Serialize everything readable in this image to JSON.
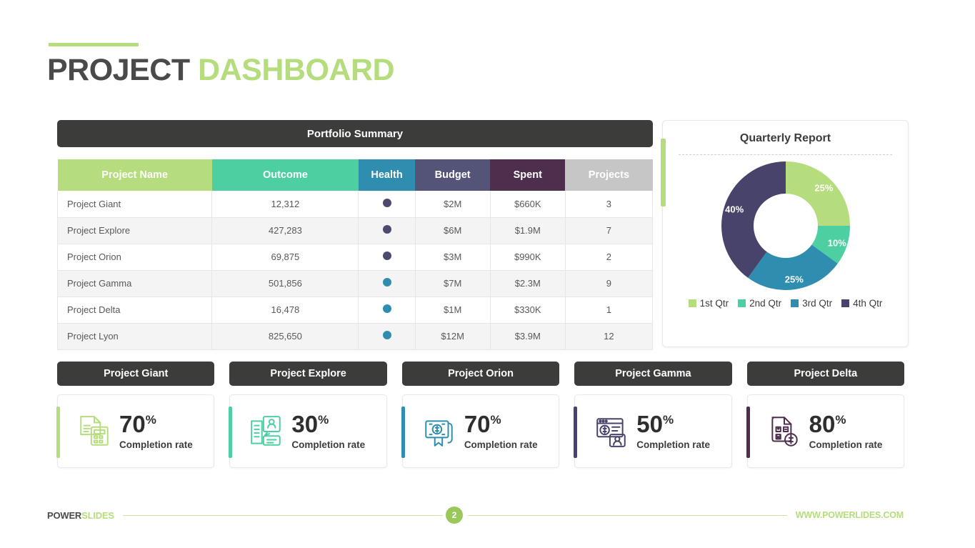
{
  "header": {
    "title_part1": "PROJECT",
    "title_part2": "DASHBOARD"
  },
  "portfolio": {
    "panel_title": "Portfolio Summary",
    "columns": [
      "Project Name",
      "Outcome",
      "Health",
      "Budget",
      "Spent",
      "Projects"
    ],
    "rows": [
      {
        "name": "Project Giant",
        "outcome": "12,312",
        "health_color": "#4b4b6e",
        "budget": "$2M",
        "spent": "$660K",
        "projects": "3"
      },
      {
        "name": "Project Explore",
        "outcome": "427,283",
        "health_color": "#4b4b6e",
        "budget": "$6M",
        "spent": "$1.9M",
        "projects": "7"
      },
      {
        "name": "Project Orion",
        "outcome": "69,875",
        "health_color": "#4b4b6e",
        "budget": "$3M",
        "spent": "$990K",
        "projects": "2"
      },
      {
        "name": "Project Gamma",
        "outcome": "501,856",
        "health_color": "#2f8eb0",
        "budget": "$7M",
        "spent": "$2.3M",
        "projects": "9"
      },
      {
        "name": "Project Delta",
        "outcome": "16,478",
        "health_color": "#2f8eb0",
        "budget": "$1M",
        "spent": "$330K",
        "projects": "1"
      },
      {
        "name": "Project Lyon",
        "outcome": "825,650",
        "health_color": "#2f8eb0",
        "budget": "$12M",
        "spent": "$3.9M",
        "projects": "12"
      }
    ]
  },
  "quarterly": {
    "title": "Quarterly Report"
  },
  "chart_data": {
    "type": "pie",
    "title": "Quarterly Report",
    "categories": [
      "1st Qtr",
      "2nd Qtr",
      "3rd Qtr",
      "4th Qtr"
    ],
    "values": [
      25,
      10,
      25,
      40
    ],
    "labels": [
      "25%",
      "10%",
      "25%",
      "40%"
    ],
    "colors": [
      "#b5dd7d",
      "#4ecfa1",
      "#2f8eb0",
      "#47436b"
    ],
    "legend_position": "bottom",
    "donut": true,
    "start_angle": 0,
    "units": "percent"
  },
  "cards": [
    {
      "title": "Project Giant",
      "percent": "70",
      "suffix": "%",
      "subtitle": "Completion rate",
      "accent": "#b5dd7d",
      "icon": "document-calculator-icon"
    },
    {
      "title": "Project Explore",
      "percent": "30",
      "suffix": "%",
      "subtitle": "Completion rate",
      "accent": "#4ecfa1",
      "icon": "book-profile-icon"
    },
    {
      "title": "Project Orion",
      "percent": "70",
      "suffix": "%",
      "subtitle": "Completion rate",
      "accent": "#2f8eb0",
      "icon": "money-certificate-icon"
    },
    {
      "title": "Project Gamma",
      "percent": "50",
      "suffix": "%",
      "subtitle": "Completion rate",
      "accent": "#47436b",
      "icon": "browser-payment-person-icon"
    },
    {
      "title": "Project Delta",
      "percent": "80",
      "suffix": "%",
      "subtitle": "Completion rate",
      "accent": "#4d2f4d",
      "icon": "invoice-dollar-icon"
    }
  ],
  "footer": {
    "brand_part1": "POWER",
    "brand_part2": "SLIDES",
    "page_number": "2",
    "website": "WWW.POWERLIDES.COM"
  }
}
